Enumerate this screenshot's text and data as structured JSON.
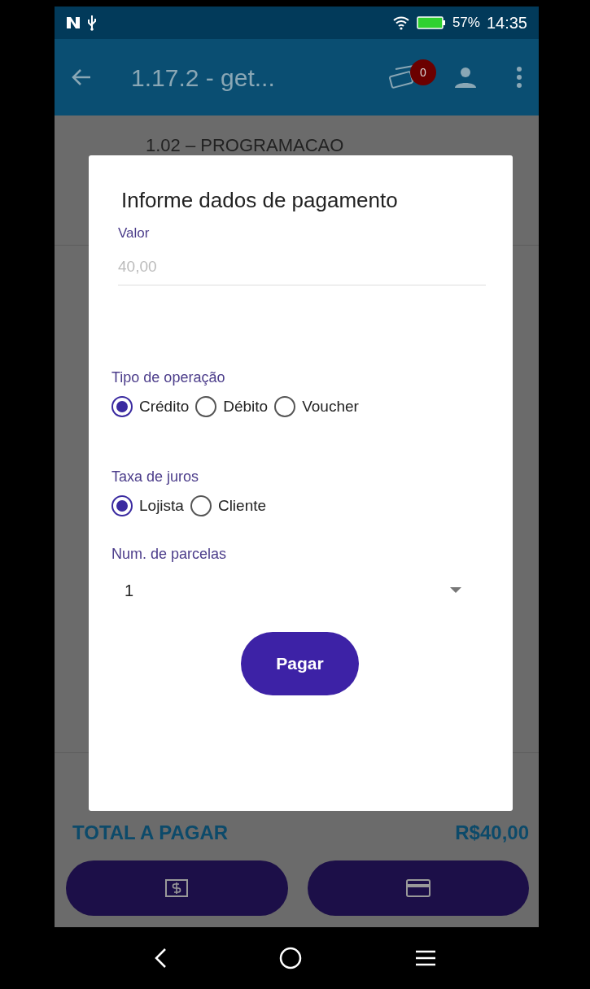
{
  "status_bar": {
    "battery": "57%",
    "time": "14:35"
  },
  "app_bar": {
    "title": "1.17.2 - get...",
    "cart_badge": "0"
  },
  "background": {
    "item_title": "1.02 – PROGRAMACAO",
    "total_label": "TOTAL A PAGAR",
    "total_amount": "R$40,00"
  },
  "dialog": {
    "title": "Informe dados de pagamento",
    "valor": {
      "label": "Valor",
      "value": "40,00",
      "disabled": true
    },
    "groups": [
      {
        "label": "Tipo de operação",
        "options": [
          {
            "label": "Crédito",
            "selected": true
          },
          {
            "label": "Débito",
            "selected": false
          },
          {
            "label": "Voucher",
            "selected": false
          }
        ]
      },
      {
        "label": "Taxa de juros",
        "options": [
          {
            "label": "Lojista",
            "selected": true
          },
          {
            "label": "Cliente",
            "selected": false
          }
        ]
      }
    ],
    "parcelas": {
      "label": "Num. de parcelas",
      "value": "1"
    },
    "submit": "Pagar"
  }
}
